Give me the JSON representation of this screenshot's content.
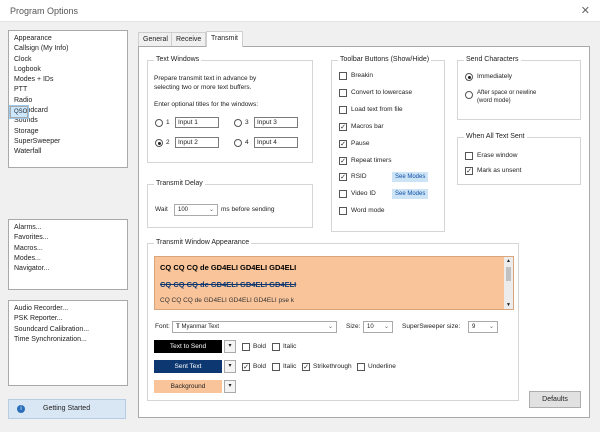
{
  "window": {
    "title": "Program Options",
    "close": "✕"
  },
  "nav": {
    "group1": [
      "Appearance",
      "Callsign (My Info)",
      "Clock",
      "Logbook",
      "Modes + IDs",
      "PTT",
      "Radio",
      "QSO",
      "Soundcard",
      "Sounds",
      "Storage",
      "SuperSweeper",
      "Waterfall"
    ],
    "selected": "QSO",
    "group2": [
      "Alarms...",
      "Favorites...",
      "Macros...",
      "Modes...",
      "Navigator..."
    ],
    "group3": [
      "Audio Recorder...",
      "PSK Reporter...",
      "Soundcard Calibration...",
      "Time Synchronization..."
    ],
    "getting_started": "Getting Started"
  },
  "tabs": [
    "General",
    "Receive",
    "Transmit"
  ],
  "text_windows": {
    "title": "Text Windows",
    "desc1": "Prepare transmit text in advance by",
    "desc2": "selecting two or more text buffers.",
    "enter_titles": "Enter optional titles for the windows:",
    "options": [
      {
        "num": "1",
        "title": "Input 1",
        "checked": false
      },
      {
        "num": "2",
        "title": "Input 2",
        "checked": true
      },
      {
        "num": "3",
        "title": "Input 3",
        "checked": false
      },
      {
        "num": "4",
        "title": "Input 4",
        "checked": false
      }
    ]
  },
  "transmit_delay": {
    "title": "Transmit Delay",
    "wait": "Wait",
    "value": "100",
    "unit": "ms before sending"
  },
  "toolbar_buttons": {
    "title": "Toolbar Buttons (Show/Hide)",
    "items": [
      {
        "label": "Breakin",
        "checked": false
      },
      {
        "label": "Convert to lowercase",
        "checked": false
      },
      {
        "label": "Load text from file",
        "checked": false
      },
      {
        "label": "Macros bar",
        "checked": true
      },
      {
        "label": "Pause",
        "checked": true
      },
      {
        "label": "Repeat timers",
        "checked": true
      },
      {
        "label": "RSID",
        "checked": true,
        "link": "See Modes"
      },
      {
        "label": "Video ID",
        "checked": false,
        "link": "See Modes"
      },
      {
        "label": "Word mode",
        "checked": false
      }
    ]
  },
  "send_characters": {
    "title": "Send Characters",
    "immediately": "Immediately",
    "after1": "After space or newline",
    "after2": "(word mode)"
  },
  "when_all_sent": {
    "title": "When All Text Sent",
    "erase": "Erase window",
    "mark": "Mark as unsent",
    "erase_checked": false,
    "mark_checked": true
  },
  "appearance": {
    "title": "Transmit Window Appearance",
    "preview_lines": [
      "CQ CQ CQ de GD4ELI GD4ELI GD4ELI",
      "CQ CQ CQ de GD4ELI GD4ELI GD4ELI",
      "CQ CQ CQ de GD4ELI GD4ELI GD4ELI pse k"
    ],
    "preview_bg": "#f9c49a",
    "font_label": "Font:",
    "font_value": "Myanmar Text",
    "size_label": "Size:",
    "size_value": "10",
    "ss_size_label": "SuperSweeper size:",
    "ss_size_value": "9",
    "text_to_send": "Text to Send",
    "sent_text": "Sent Text",
    "background": "Background",
    "bold": "Bold",
    "italic": "Italic",
    "strikethrough": "Strikethrough",
    "underline": "Underline",
    "colors": {
      "text_to_send": "#000000",
      "sent_text": "#0d3770",
      "background": "#f9c49a"
    }
  },
  "defaults": "Defaults"
}
